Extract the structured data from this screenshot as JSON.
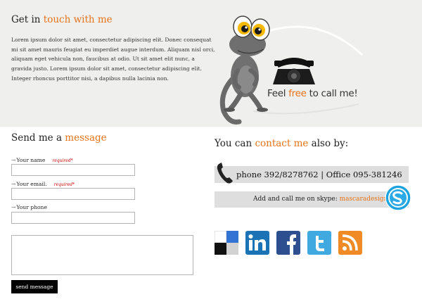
{
  "intro": {
    "title_plain": "Get in ",
    "title_accent": "touch with me",
    "body": "Lorem ipsum dolor sit amet, consectetur adipiscing elit. Donec consequat mi sit amet mauris feugiat eu imperdiet augue interdum. Aliquam nisl orci, aliquam eget vehicula non, faucibus at odio. Ut sit amet elit nunc, a gravida justo. Lorem ipsum dolor sit amet, consectetur adipiscing elit. Integer rhoncus porttitor nisi, a dapibus nulla lacinia non."
  },
  "illustration": {
    "slogan_before": "Feel ",
    "slogan_accent": "free",
    "slogan_after": " to call me!",
    "icon": "gecko-with-telephone"
  },
  "form": {
    "title_plain": "Send me a ",
    "title_accent": "message",
    "fields": [
      {
        "label": "Your name",
        "required": "required*",
        "value": ""
      },
      {
        "label": "Your email.",
        "required": "required*",
        "value": ""
      },
      {
        "label": "Your phone",
        "value": ""
      }
    ],
    "message_value": "",
    "send_label": "send message"
  },
  "contact": {
    "title_plain": "You can ",
    "title_accent": "contact me",
    "title_after": " also by:",
    "phone_text": "phone  392/8278762  | Office 095-381246",
    "skype_text": "Add and call me on skype: ",
    "skype_link": "mascaradesign",
    "icons": [
      "phone-icon",
      "skype-icon"
    ]
  },
  "social": [
    {
      "name": "delicious-icon"
    },
    {
      "name": "linkedin-icon"
    },
    {
      "name": "facebook-icon"
    },
    {
      "name": "twitter-icon"
    },
    {
      "name": "rss-icon"
    }
  ],
  "colors": {
    "accent": "#e8731b",
    "top_background": "#efefed",
    "bar_background": "#dedede",
    "required": "#cc0000"
  }
}
